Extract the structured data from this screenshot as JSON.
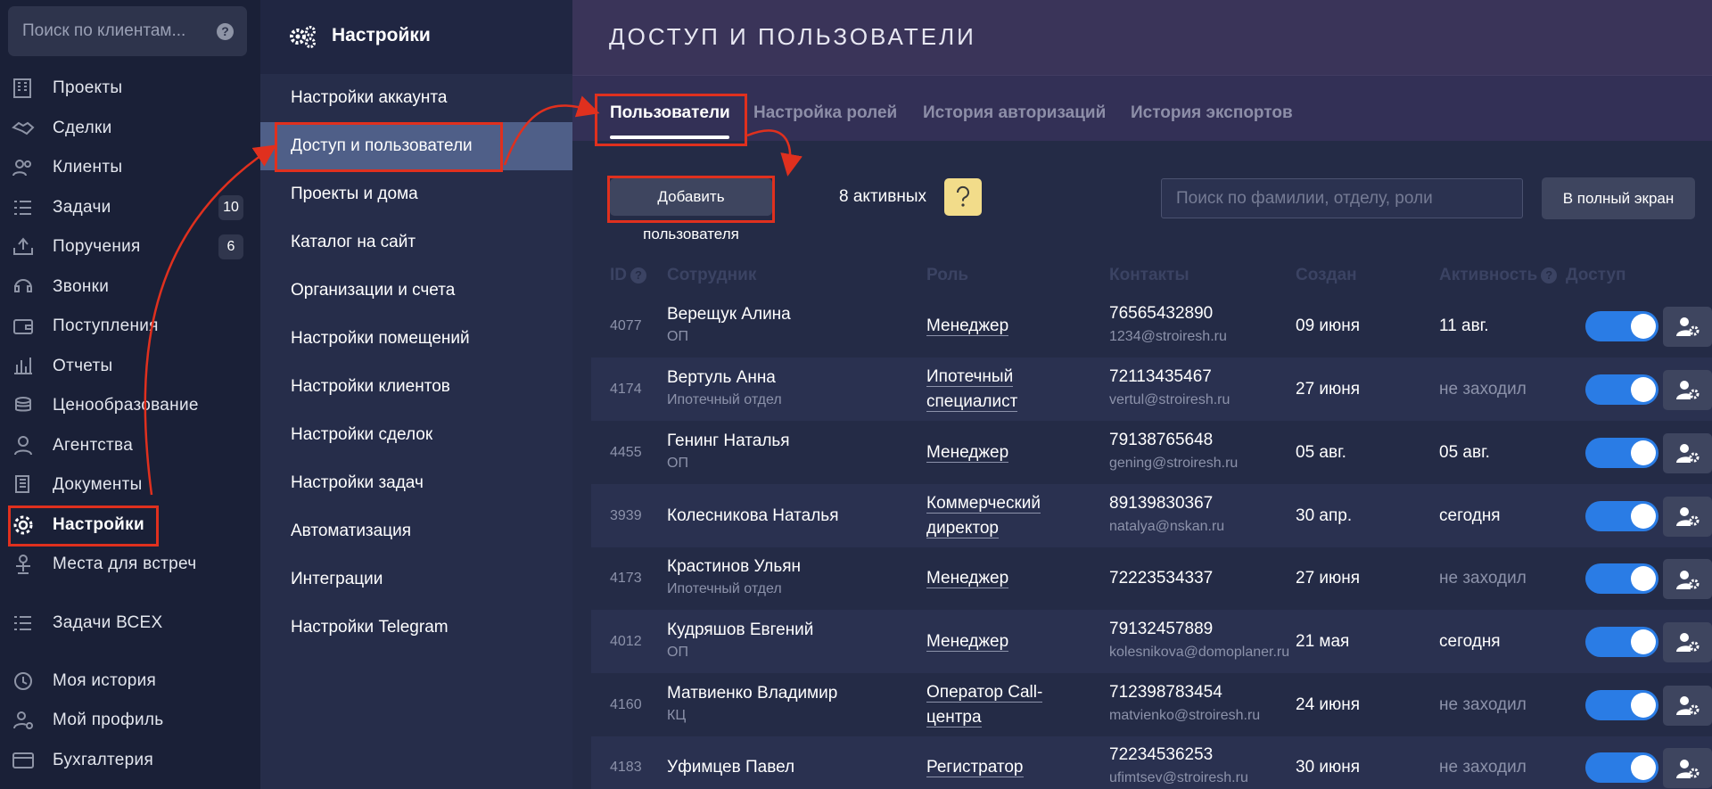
{
  "leftnav": {
    "search_placeholder": "Поиск по клиентам...",
    "items": [
      {
        "label": "Проекты",
        "icon": "building-icon"
      },
      {
        "label": "Сделки",
        "icon": "handshake-icon"
      },
      {
        "label": "Клиенты",
        "icon": "users-icon"
      },
      {
        "label": "Задачи",
        "icon": "tasks-icon",
        "badge": "10"
      },
      {
        "label": "Поручения",
        "icon": "inbox-upload-icon",
        "badge": "6"
      },
      {
        "label": "Звонки",
        "icon": "headset-icon"
      },
      {
        "label": "Поступления",
        "icon": "wallet-icon"
      },
      {
        "label": "Отчеты",
        "icon": "chart-icon"
      },
      {
        "label": "Ценообразование",
        "icon": "coins-icon"
      },
      {
        "label": "Агентства",
        "icon": "agent-icon"
      },
      {
        "label": "Документы",
        "icon": "documents-icon"
      },
      {
        "label": "Настройки",
        "icon": "gear-icon"
      },
      {
        "label": "Места для встреч",
        "icon": "podium-icon"
      },
      {
        "label": "Задачи ВСЕХ",
        "icon": "tasks-icon"
      },
      {
        "label": "Моя история",
        "icon": "history-icon"
      },
      {
        "label": "Мой профиль",
        "icon": "profile-gear-icon"
      },
      {
        "label": "Бухгалтерия",
        "icon": "card-icon"
      }
    ]
  },
  "settings": {
    "title": "Настройки",
    "items": [
      "Настройки аккаунта",
      "Доступ и пользователи",
      "Проекты и дома",
      "Каталог на сайт",
      "Организации и счета",
      "Настройки помещений",
      "Настройки клиентов",
      "Настройки сделок",
      "Настройки задач",
      "Автоматизация",
      "Интеграции",
      "Настройки Telegram"
    ]
  },
  "main": {
    "title": "ДОСТУП И ПОЛЬЗОВАТЕЛИ",
    "tabs": [
      "Пользователи",
      "Настройка ролей",
      "История авторизаций",
      "История экспортов"
    ],
    "add_button": "Добавить пользователя",
    "active_count": "8 активных",
    "search_placeholder": "Поиск по фамилии, отделу, роли",
    "fullscreen_button": "В полный экран",
    "columns": [
      "ID",
      "Сотрудник",
      "Роль",
      "Контакты",
      "Создан",
      "Активность",
      "Доступ"
    ],
    "rows": [
      {
        "id": "4077",
        "name": "Верещук Алина",
        "dept": "ОП",
        "role": "Менеджер",
        "phone": "76565432890",
        "email": "1234@stroiresh.ru",
        "created": "09 июня",
        "activity": "11 авг."
      },
      {
        "id": "4174",
        "name": "Вертуль Анна",
        "dept": "Ипотечный отдел",
        "role": "Ипотечный специалист",
        "phone": "72113435467",
        "email": "vertul@stroiresh.ru",
        "created": "27 июня",
        "activity": "не заходил"
      },
      {
        "id": "4455",
        "name": "Генинг Наталья",
        "dept": "ОП",
        "role": "Менеджер",
        "phone": "79138765648",
        "email": "gening@stroiresh.ru",
        "created": "05 авг.",
        "activity": "05 авг."
      },
      {
        "id": "3939",
        "name": "Колесникова Наталья",
        "dept": "",
        "role": "Коммерческий директор",
        "phone": "89139830367",
        "email": "natalya@nskan.ru",
        "created": "30 апр.",
        "activity": "сегодня"
      },
      {
        "id": "4173",
        "name": "Крастинов Ульян",
        "dept": "Ипотечный отдел",
        "role": "Менеджер",
        "phone": "72223534337",
        "email": "",
        "created": "27 июня",
        "activity": "не заходил"
      },
      {
        "id": "4012",
        "name": "Кудряшов Евгений",
        "dept": "ОП",
        "role": "Менеджер",
        "phone": "79132457889",
        "email": "kolesnikova@domoplaner.ru",
        "created": "21 мая",
        "activity": "сегодня"
      },
      {
        "id": "4160",
        "name": "Матвиенко Владимир",
        "dept": "КЦ",
        "role": "Оператор Call-центра",
        "phone": "712398783454",
        "email": "matvienko@stroiresh.ru",
        "created": "24 июня",
        "activity": "не заходил"
      },
      {
        "id": "4183",
        "name": "Уфимцев Павел",
        "dept": "",
        "role": "Регистратор",
        "phone": "72234536253",
        "email": "ufimtsev@stroiresh.ru",
        "created": "30 июня",
        "activity": "не заходил"
      }
    ]
  },
  "colors": {
    "highlight": "#e0301e",
    "toggle_on": "#2a7ce5",
    "hint": "#f2dc8a"
  }
}
